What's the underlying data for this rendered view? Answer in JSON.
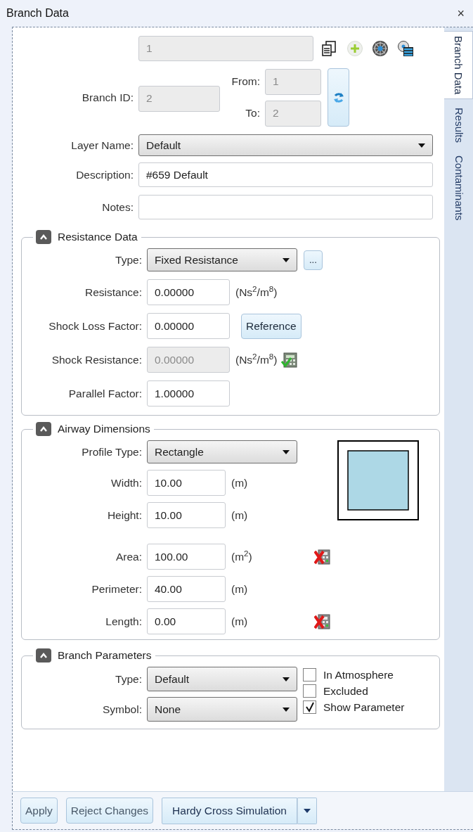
{
  "window": {
    "title": "Branch Data",
    "close": "×"
  },
  "tabs": [
    {
      "label": "Branch Data",
      "selected": true
    },
    {
      "label": "Results",
      "selected": false
    },
    {
      "label": "Contaminants",
      "selected": false
    }
  ],
  "header": {
    "name_field": {
      "value": "1",
      "disabled": true
    },
    "branch_id": {
      "label": "Branch ID:",
      "value": "2",
      "disabled": true
    },
    "from": {
      "label": "From:",
      "value": "1",
      "disabled": true
    },
    "to": {
      "label": "To:",
      "value": "2",
      "disabled": true
    }
  },
  "general": [
    {
      "kind": "select",
      "label": "Layer Name:",
      "value": "Default"
    },
    {
      "kind": "field",
      "label": "Description:",
      "value": "#659 Default",
      "disabled": false
    },
    {
      "kind": "field",
      "label": "Notes:",
      "disabled": false
    }
  ],
  "groups": [
    {
      "title": "Resistance Data",
      "expanded": true,
      "rows": [
        {
          "kind": "select",
          "label": "Type:",
          "value": "Fixed Resistance",
          "more_button": "..."
        },
        {
          "kind": "field",
          "label": "Resistance:",
          "value": "0.00000",
          "disabled": false,
          "unit": "(Ns$^{2}$/m$^{8}$)"
        },
        {
          "kind": "field",
          "label": "Shock Loss Factor:",
          "value": "0.00000",
          "disabled": false,
          "button": "Reference"
        },
        {
          "kind": "field",
          "label": "Shock Resistance:",
          "value": "0.00000",
          "disabled": true,
          "unit": "(Ns$^{2}$/m$^{8}$)",
          "calc_ok": true
        },
        {
          "kind": "field",
          "label": "Parallel Factor:",
          "value": "1.00000",
          "disabled": false
        }
      ]
    },
    {
      "title": "Airway Dimensions",
      "expanded": true,
      "preview": true,
      "shape_rows": [
        {
          "kind": "select",
          "label": "Profile Type:",
          "value": "Rectangle"
        },
        {
          "kind": "field",
          "label": "Width:",
          "value": "10.00",
          "disabled": false,
          "unit": "(m)"
        },
        {
          "kind": "field",
          "label": "Height:",
          "value": "10.00",
          "disabled": false,
          "unit": "(m)"
        }
      ],
      "rows": [
        {
          "kind": "field",
          "label": "Area:",
          "value": "100.00",
          "disabled": false,
          "unit": "(m$^{2}$)",
          "calc_ok": false
        },
        {
          "kind": "field",
          "label": "Perimeter:",
          "value": "40.00",
          "disabled": false,
          "unit": "(m)"
        },
        {
          "kind": "field",
          "label": "Length:",
          "value": "0.00",
          "disabled": false,
          "unit": "(m)",
          "calc_ok": false
        }
      ]
    },
    {
      "title": "Branch Parameters",
      "expanded": true,
      "rows": [
        {
          "kind": "select",
          "label": "Type:",
          "value": "Default"
        },
        {
          "kind": "select",
          "label": "Symbol:",
          "value": "None"
        }
      ],
      "checkboxes": [
        {
          "label": "In Atmosphere",
          "checked": false
        },
        {
          "label": "Excluded",
          "checked": false
        },
        {
          "label": "Show Parameter",
          "checked": true
        }
      ]
    }
  ],
  "buttons": [
    {
      "label": "Apply"
    },
    {
      "label": "Reject Changes"
    }
  ],
  "split_button": {
    "label": "Hardy Cross Simulation"
  }
}
